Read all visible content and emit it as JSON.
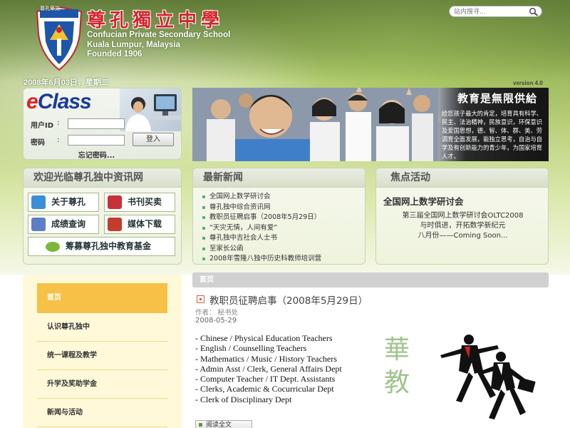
{
  "header": {
    "logo_top_text": "尊孔華文",
    "school_name_cn": "尊孔獨立中學",
    "school_name_en": "Confucian Private Secondary School",
    "location": "Kuala Lumpur, Malaysia",
    "founded": "Founded 1906",
    "date": "2008年6月03日，星期二",
    "version": "version 4.0",
    "search": {
      "placeholder": "站内搜寻..."
    }
  },
  "eclass": {
    "logo_e": "e",
    "logo_class": "Class",
    "userid_label": "用户ID",
    "password_label": "密码",
    "colon": ":",
    "login_button": "登入",
    "forgot": "忘记密码..."
  },
  "banner": {
    "title": "教育是無限供給",
    "text": "给您孩子最大的肯定，培育具有科学、民主、法治精神，民族意识，环保意识及爱国思想，德、智、体、群、美、劳调育全面发展，能独立思考，自治与自学及有创新能力的青少年，为国家培育人才。"
  },
  "welcome": {
    "title": "欢迎光临尊孔独中资讯网",
    "buttons": [
      {
        "label": "关于尊孔"
      },
      {
        "label": "书刊买卖"
      },
      {
        "label": "成绩查询"
      },
      {
        "label": "媒体下载"
      },
      {
        "label": "筹募尊孔独中教育基金"
      }
    ]
  },
  "news": {
    "title": "最新新闻",
    "items": [
      "全国网上数学研讨会",
      "尊孔独中综合资讯网",
      "教职员征聘启事（2008年5月29日）",
      "“天灾无情，人间有爱”",
      "尊孔独中吉社会人士书",
      "至家长公函",
      "2008年雪隆八独中历史科教师培训营"
    ]
  },
  "focus": {
    "title": "焦点活动",
    "event_title": "全国网上数学研讨会",
    "lines": [
      "第三届全国网上数学研讨会OLTC2008",
      "与时俱进，开拓数学新纪元",
      "八月份——Coming Soon..."
    ]
  },
  "sidebar": {
    "items": [
      {
        "label": "首页"
      },
      {
        "label": "认识尊孔独中"
      },
      {
        "label": "统一课程及教学"
      },
      {
        "label": "升学及奖助学金"
      },
      {
        "label": "新闻与活动"
      }
    ]
  },
  "main": {
    "breadcrumb": "首页",
    "article": {
      "title": "教职员征聘启事（2008年5月29日）",
      "author": "作者： 秘书处",
      "date": "2008-05-29",
      "positions": [
        "- Chinese / Physical Education Teachers",
        "- English / Counselling Teachers",
        "- Mathematics / Music / History Teachers",
        "- Admin Asst / Clerk, General Affairs Dept",
        "- Computer Teacher / IT Dept. Assistants",
        "- Clerks, Academic & Cocurricular Dept",
        "- Clerk of Disciplinary Dept"
      ],
      "read_more": "阅读全文",
      "graphic_text": "華教"
    }
  },
  "colors": {
    "accent_red": "#d4242a",
    "sidebar_active": "#f6c146",
    "sidebar_bg": "#fff9d9",
    "breadcrumb_bg": "#d1d1d1"
  },
  "icons": [
    "logo-emblem",
    "search-icon",
    "about-icon",
    "books-icon",
    "results-icon",
    "download-icon",
    "fund-icon",
    "article-icon",
    "runners-graphic"
  ]
}
